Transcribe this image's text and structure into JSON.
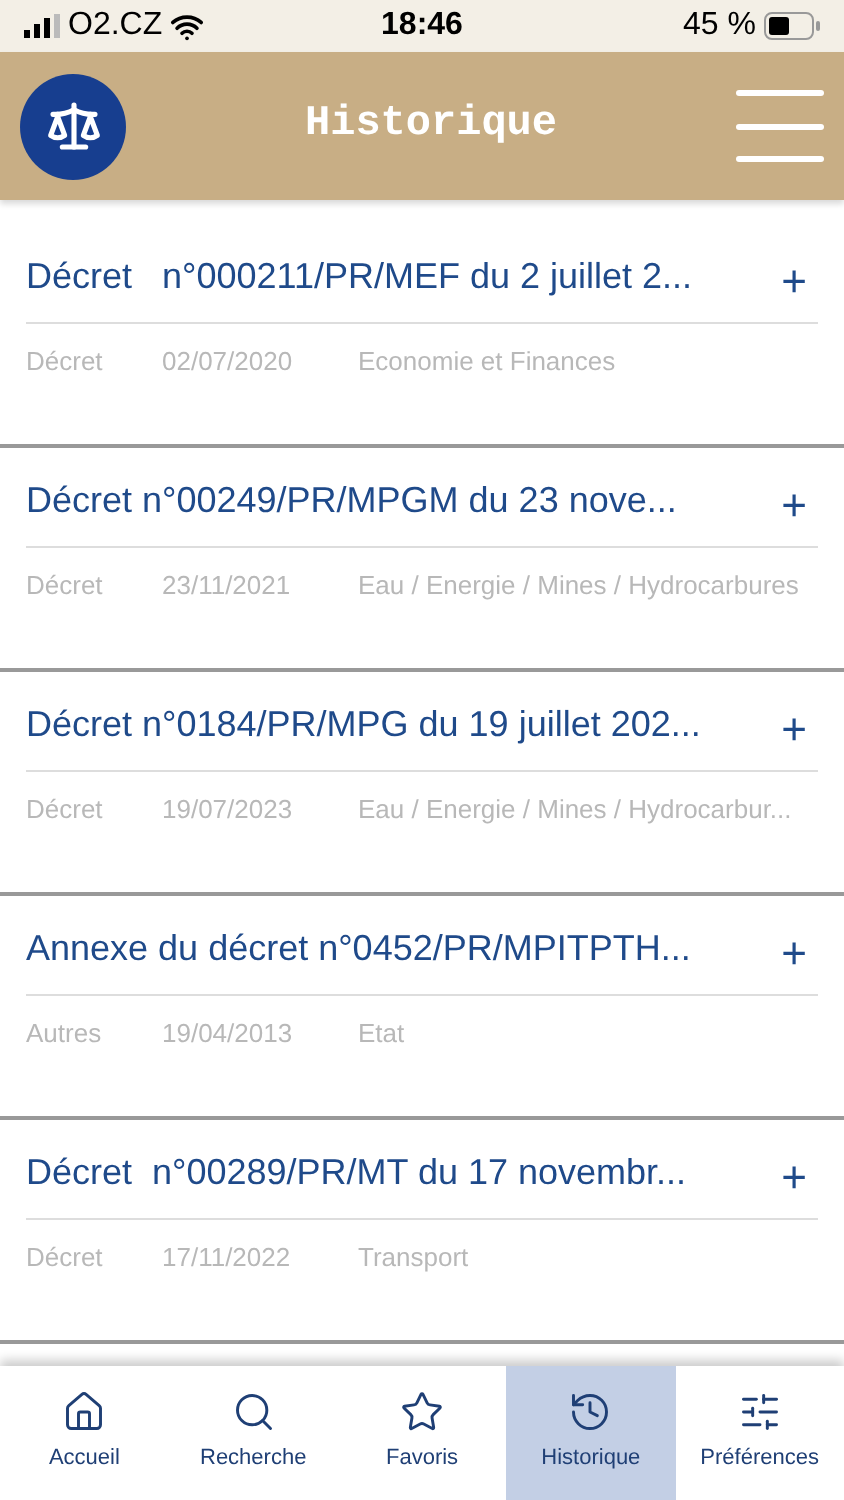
{
  "status_bar": {
    "carrier": "O2.CZ",
    "time": "18:46",
    "battery": "45 %"
  },
  "header": {
    "title": "Historique"
  },
  "items": [
    {
      "title": "Décret   n°000211/PR/MEF du 2 juillet 2...",
      "toggle": "+",
      "type": "Décret",
      "date": "02/07/2020",
      "domain": "Economie et Finances"
    },
    {
      "title": "Décret n°00249/PR/MPGM du 23 nove...",
      "toggle": "+",
      "type": "Décret",
      "date": "23/11/2021",
      "domain": "Eau / Energie / Mines / Hydrocarbures"
    },
    {
      "title": "Décret n°0184/PR/MPG du 19 juillet 202...",
      "toggle": "+",
      "type": "Décret",
      "date": "19/07/2023",
      "domain": "Eau / Energie / Mines / Hydrocarbur..."
    },
    {
      "title": "Annexe du décret n°0452/PR/MPITPTH...",
      "toggle": "+",
      "type": "Autres",
      "date": "19/04/2013",
      "domain": "Etat"
    },
    {
      "title": "Décret  n°00289/PR/MT du 17 novembr...",
      "toggle": "+",
      "type": "Décret",
      "date": "17/11/2022",
      "domain": "Transport"
    }
  ],
  "tab_bar": [
    {
      "label": "Accueil",
      "kind": "home",
      "selected": false
    },
    {
      "label": "Recherche",
      "kind": "search",
      "selected": false
    },
    {
      "label": "Favoris",
      "kind": "star",
      "selected": false
    },
    {
      "label": "Historique",
      "kind": "history",
      "selected": true
    },
    {
      "label": "Préférences",
      "kind": "settings",
      "selected": false
    }
  ]
}
